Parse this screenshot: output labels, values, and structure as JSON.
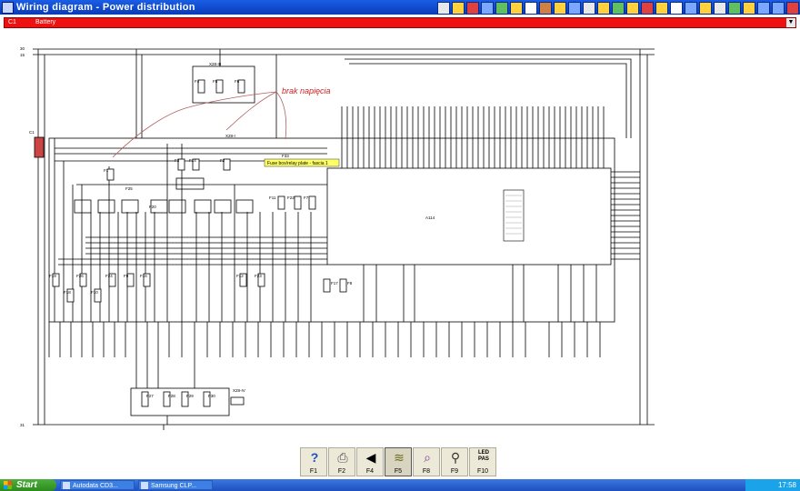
{
  "window": {
    "title": "Wiring diagram - Power distribution"
  },
  "circuit_select": {
    "code": "C1",
    "name": "Battery"
  },
  "annotation": {
    "text": "brak napięcia"
  },
  "tooltip": {
    "text": "Fuse box/relay plate - fascia 1"
  },
  "diagram_labels": {
    "rail_30": "30",
    "rail_15": "15",
    "rail_31": "31",
    "connector_x28_iii": "X28-III",
    "connector_x28_i": "X28-I",
    "connector_x28_iv": "X28-IV",
    "connector_c1": "C1",
    "module": "A114",
    "fuse_f1": "F1",
    "fuse_f2": "F2",
    "fuse_f3": "F3",
    "fuse_f4": "F4",
    "fuse_f5": "F5",
    "fuse_f6": "F6",
    "fuse_f7": "F7",
    "fuse_f8": "F8",
    "fuse_f9": "F9",
    "fuse_f10": "F10",
    "fuse_f11": "F11",
    "fuse_f12": "F12",
    "fuse_f14": "F14",
    "fuse_f16": "F16",
    "fuse_f17": "F17",
    "fuse_f18": "F18",
    "fuse_f19": "F19",
    "fuse_f20": "F20",
    "fuse_f22": "F22",
    "fuse_f23": "F23",
    "fuse_f24": "F24",
    "fuse_f25": "F25",
    "fuse_f26": "F26",
    "fuse_f27": "F27",
    "fuse_f28": "F28",
    "fuse_f29": "F29",
    "fuse_f30": "F30",
    "fuse_f33": "F33"
  },
  "toolbar": {
    "buttons": [
      {
        "label": "F1",
        "icon": "help-icon"
      },
      {
        "label": "F2",
        "icon": "print-icon"
      },
      {
        "label": "F4",
        "icon": "back-icon"
      },
      {
        "label": "F5",
        "icon": "wiring-icon"
      },
      {
        "label": "F8",
        "icon": "zoom-icon"
      },
      {
        "label": "F9",
        "icon": "find-icon"
      },
      {
        "label": "F10",
        "icon": "led-pass-icon"
      }
    ],
    "led_text": "LED\nPAS"
  },
  "taskbar": {
    "start_label": "Start",
    "tasks": [
      "Autodata CD3...",
      "Samsung CLP..."
    ],
    "clock": "17:58"
  },
  "colors": {
    "title_blue": "#0a3bb8",
    "select_red": "#ee1111",
    "annotation_red": "#cc2222",
    "wire": "#000000"
  }
}
